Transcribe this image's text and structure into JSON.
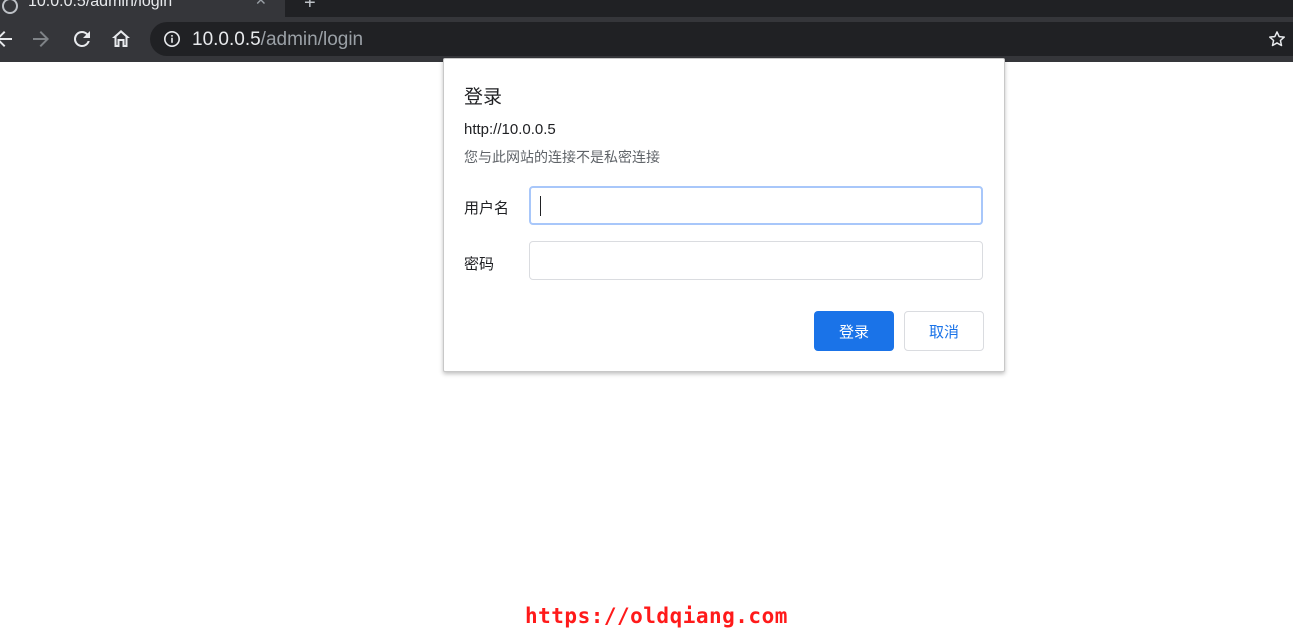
{
  "browser": {
    "tab": {
      "title": "10.0.0.5/admin/login",
      "favicon": "globe-icon",
      "close": "✕"
    },
    "new_tab": "+",
    "nav": {
      "back": "back-arrow-icon",
      "forward": "forward-arrow-icon",
      "reload": "reload-icon",
      "home": "home-icon"
    },
    "address": {
      "host": "10.0.0.5",
      "path": "/admin/login",
      "info": "info-icon",
      "bookmark": "star-icon"
    }
  },
  "dialog": {
    "title": "登录",
    "origin": "http://10.0.0.5",
    "warning": "您与此网站的连接不是私密连接",
    "username": {
      "label": "用户名",
      "value": ""
    },
    "password": {
      "label": "密码",
      "value": ""
    },
    "buttons": {
      "login": "登录",
      "cancel": "取消"
    }
  },
  "watermark": "https://oldqiang.com",
  "colors": {
    "chrome_dark": "#202124",
    "toolbar": "#35363a",
    "primary": "#1a73e8",
    "watermark": "#ff1a1a"
  }
}
